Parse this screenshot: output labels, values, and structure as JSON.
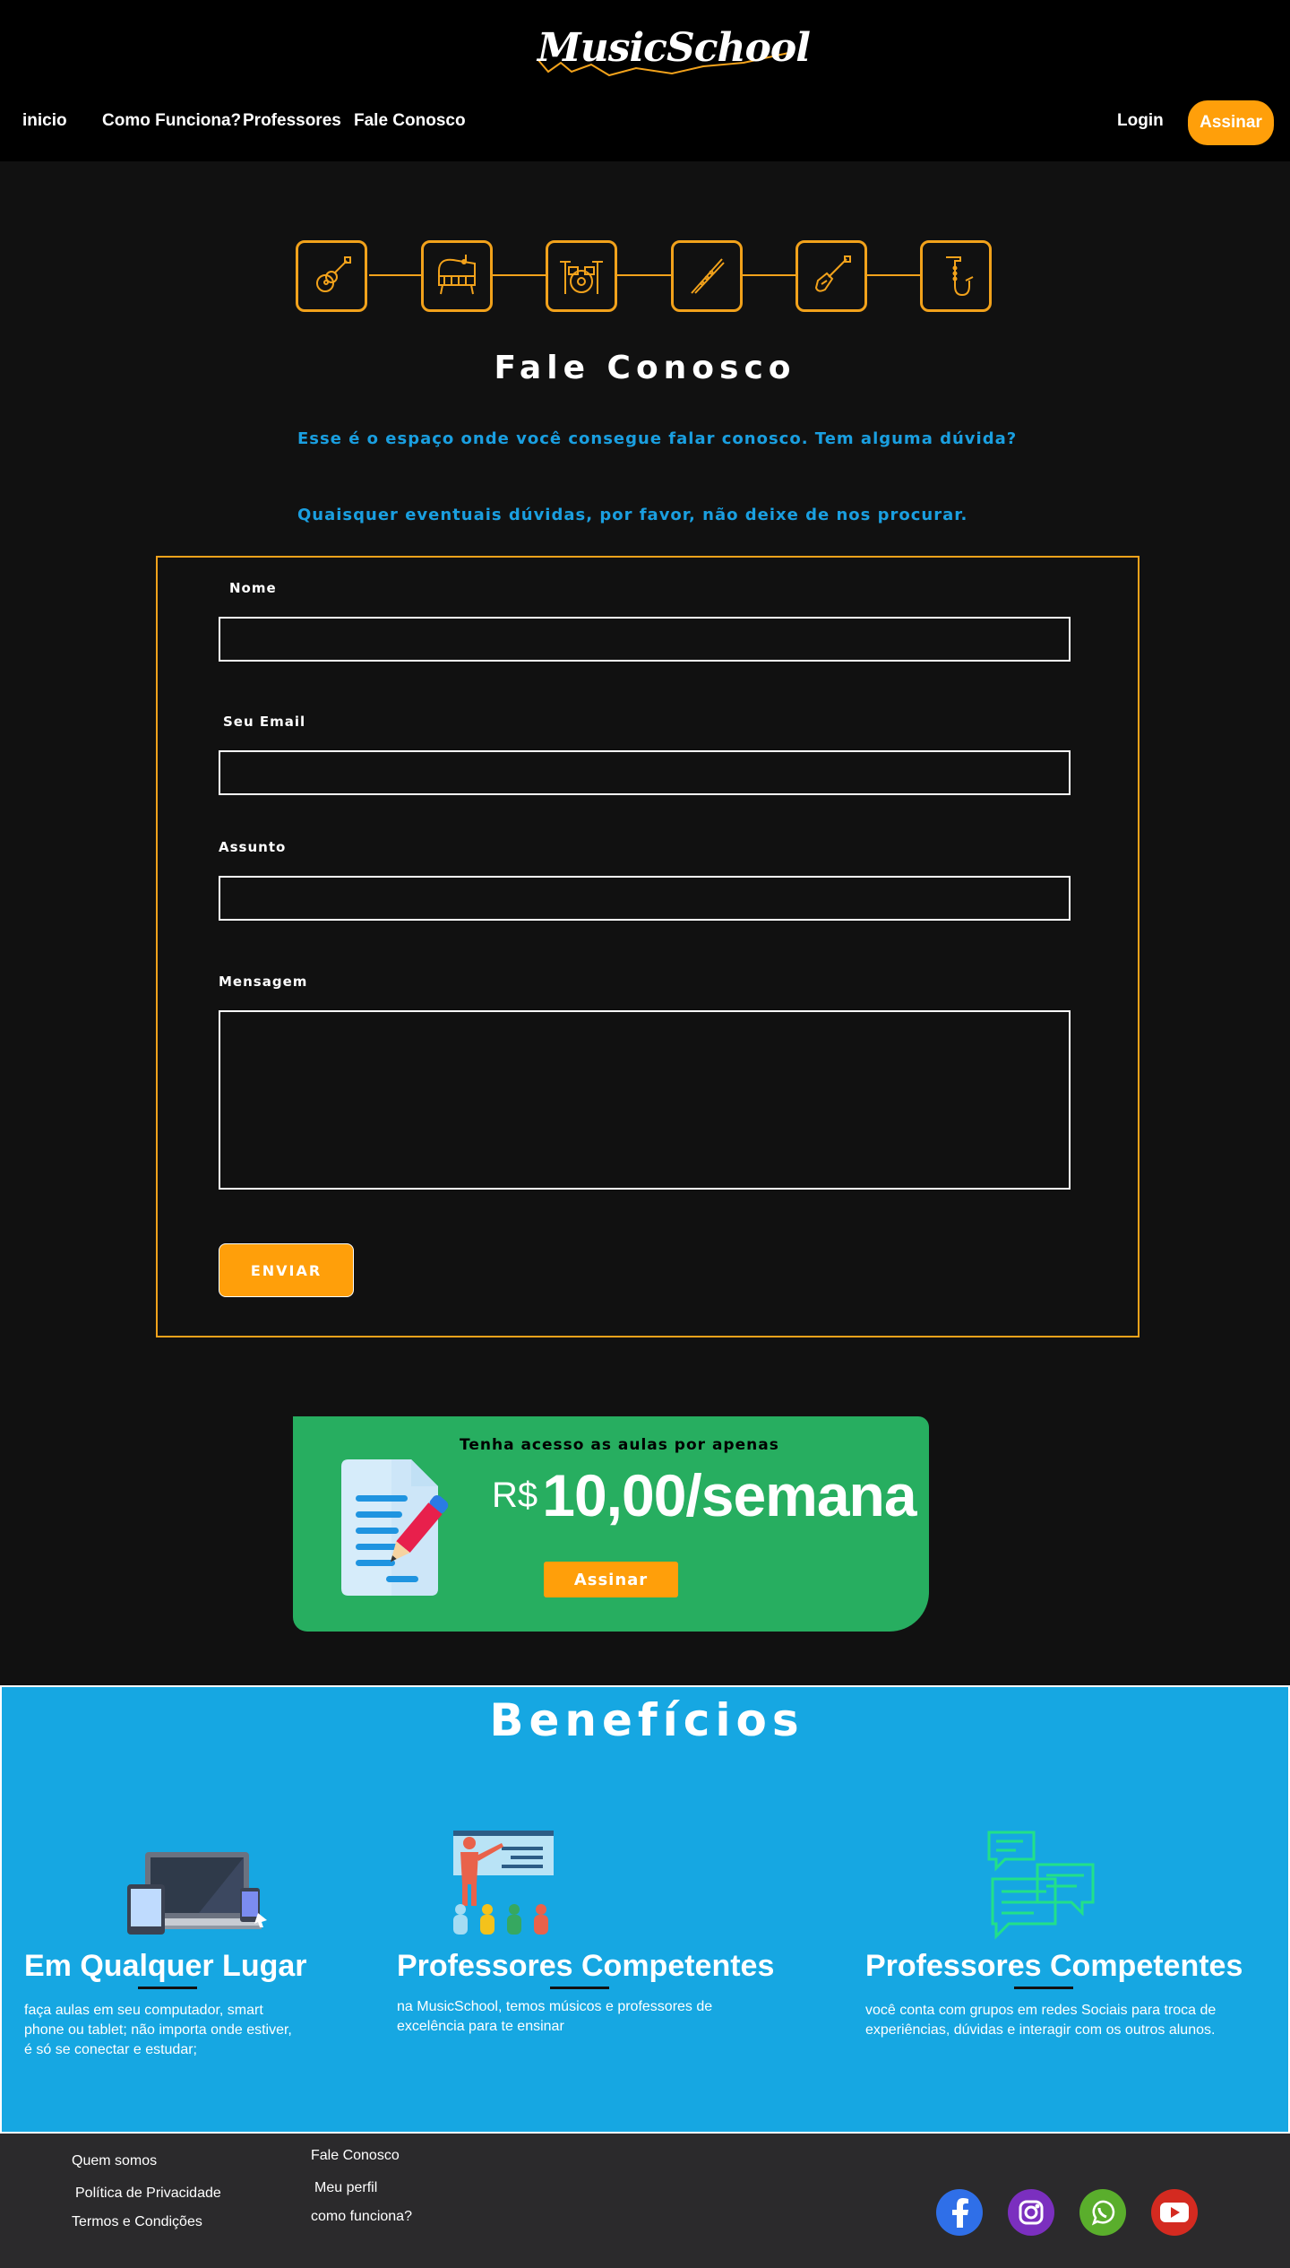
{
  "brand": {
    "logo_text": "MusicSchool"
  },
  "nav": {
    "items": [
      {
        "label": "inicio"
      },
      {
        "label": "Como Funciona?"
      },
      {
        "label": "Professores"
      },
      {
        "label": "Fale Conosco"
      }
    ],
    "login_label": "Login",
    "cta_label": "Assinar"
  },
  "instruments": [
    "guitar-icon",
    "piano-icon",
    "drums-icon",
    "flute-icon",
    "electric-guitar-icon",
    "saxophone-icon"
  ],
  "contact": {
    "title": "Fale Conosco",
    "intro_1": "Esse é o espaço onde você consegue falar conosco. Tem alguma dúvida?",
    "intro_2": "Quaisquer eventuais dúvidas, por favor, não deixe de nos procurar.",
    "form": {
      "name_label": "Nome",
      "name_value": "",
      "email_label": "Seu Email",
      "email_value": "",
      "subject_label": "Assunto",
      "subject_value": "",
      "message_label": "Mensagem",
      "message_value": "",
      "submit_label": "ENVIAR"
    }
  },
  "promo": {
    "subtitle": "Tenha acesso as aulas por apenas",
    "currency": "R$",
    "price": "10,00/semana",
    "cta_label": "Assinar"
  },
  "benefits": {
    "title": "Benefícios",
    "items": [
      {
        "title": "Em Qualquer Lugar",
        "text_lines": [
          "faça aulas em seu computador, smart",
          "phone ou tablet; não importa onde estiver,",
          "é só se conectar e estudar;"
        ]
      },
      {
        "title": "Professores Competentes",
        "text_lines": [
          "na MusicSchool, temos músicos e professores de",
          "excelência para te ensinar"
        ]
      },
      {
        "title": "Professores Competentes",
        "text_lines": [
          "você conta com grupos em redes Sociais para troca de",
          "experiências, dúvidas e interagir com os outros alunos."
        ]
      }
    ]
  },
  "footer": {
    "col1": [
      "Quem somos",
      "Política de Privacidade",
      "Termos e Condições"
    ],
    "col2": [
      "Fale Conosco",
      "Meu perfil",
      "como funciona?"
    ],
    "socials": [
      "facebook-icon",
      "instagram-icon",
      "whatsapp-icon",
      "youtube-icon"
    ],
    "colors": {
      "accent": "#ff9f0a",
      "blue": "#16a7e2",
      "green": "#27ae60"
    }
  }
}
